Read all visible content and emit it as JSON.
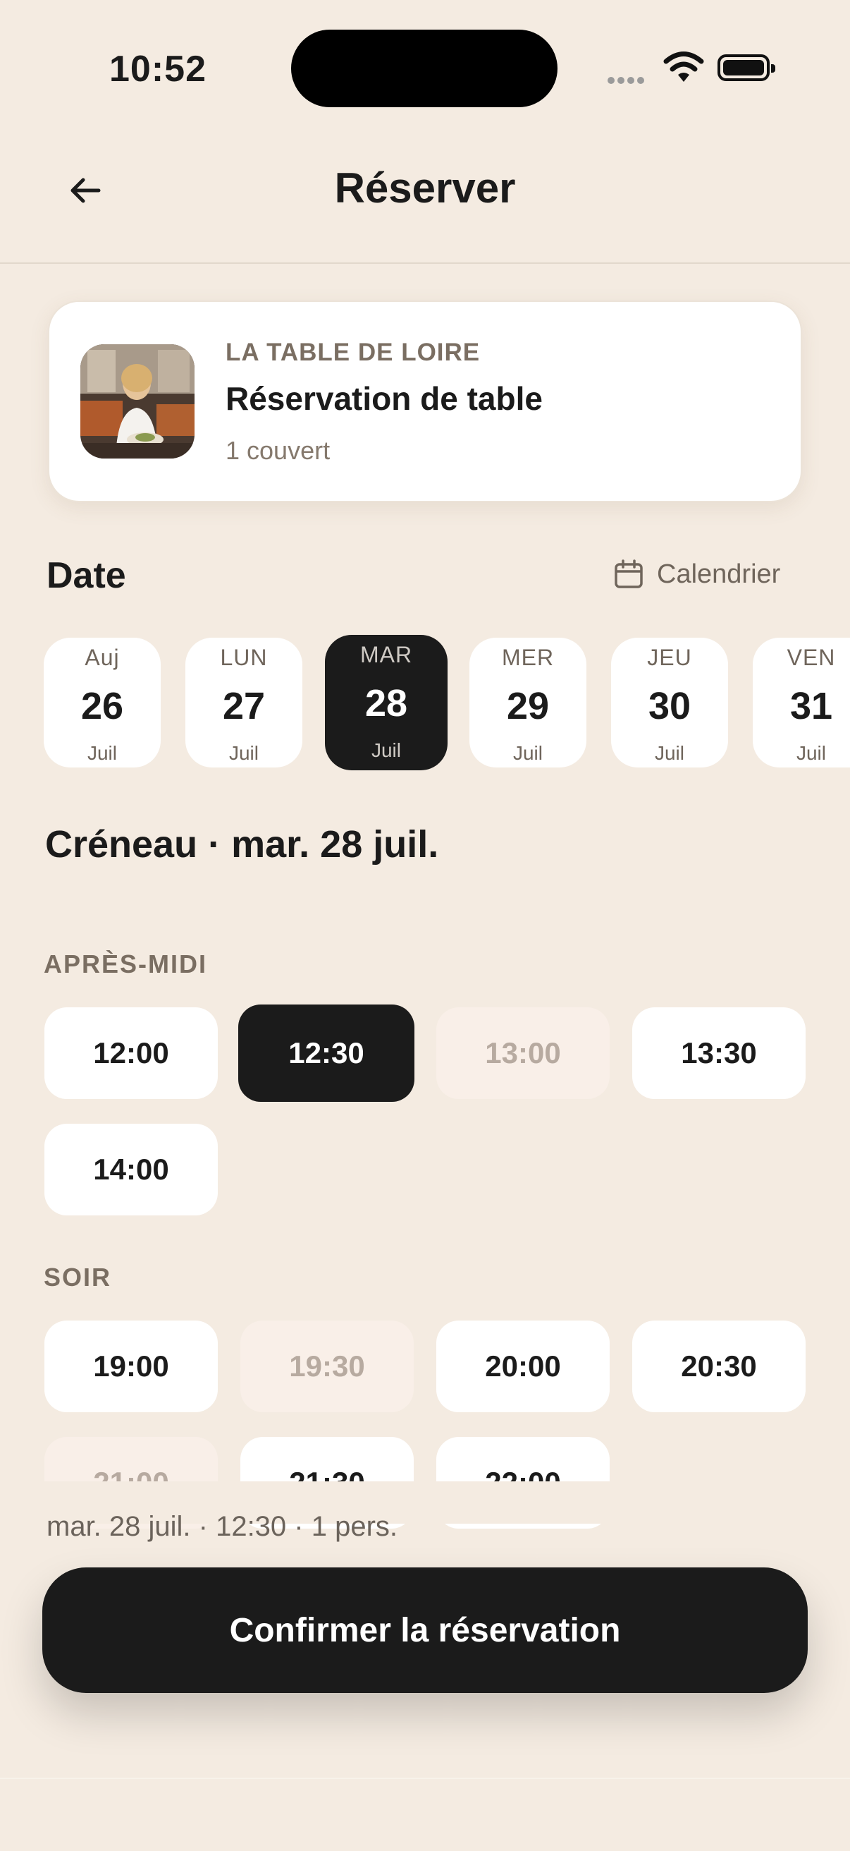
{
  "status_bar": {
    "time": "10:52"
  },
  "header": {
    "title": "Réserver"
  },
  "card": {
    "restaurant": "LA TABLE DE LOIRE",
    "type": "Réservation de table",
    "covers": "1 couvert"
  },
  "date_section": {
    "title": "Date",
    "calendar_label": "Calendrier",
    "days": [
      {
        "name": "Auj",
        "num": "26",
        "month": "Juil"
      },
      {
        "name": "LUN",
        "num": "27",
        "month": "Juil"
      },
      {
        "name": "MAR",
        "num": "28",
        "month": "Juil"
      },
      {
        "name": "MER",
        "num": "29",
        "month": "Juil"
      },
      {
        "name": "JEU",
        "num": "30",
        "month": "Juil"
      },
      {
        "name": "VEN",
        "num": "31",
        "month": "Juil"
      }
    ],
    "selected_index": 2
  },
  "creneau_title": "Créneau · mar. 28 juil.",
  "afternoon": {
    "label": "APRÈS-MIDI",
    "slots": [
      {
        "time": "12:00",
        "state": "available"
      },
      {
        "time": "12:30",
        "state": "selected"
      },
      {
        "time": "13:00",
        "state": "unavailable"
      },
      {
        "time": "13:30",
        "state": "available"
      },
      {
        "time": "14:00",
        "state": "available"
      }
    ]
  },
  "evening": {
    "label": "SOIR",
    "slots": [
      {
        "time": "19:00",
        "state": "available"
      },
      {
        "time": "19:30",
        "state": "unavailable"
      },
      {
        "time": "20:00",
        "state": "available"
      },
      {
        "time": "20:30",
        "state": "available"
      },
      {
        "time": "21:00",
        "state": "unavailable"
      },
      {
        "time": "21:30",
        "state": "available"
      },
      {
        "time": "22:00",
        "state": "available"
      }
    ]
  },
  "summary": "mar. 28 juil. · 12:30 · 1 pers.",
  "confirm_label": "Confirmer la réservation",
  "colors": {
    "background": "#f4ebe1",
    "dark": "#1b1b1b",
    "muted": "#7a6e62"
  }
}
